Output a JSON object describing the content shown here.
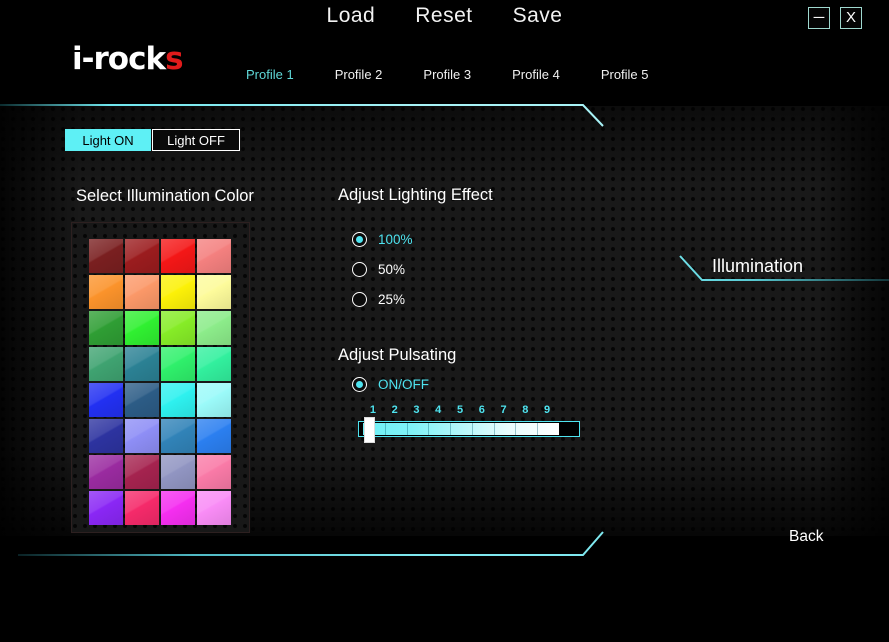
{
  "window": {
    "minimize_label": "─",
    "close_label": "X"
  },
  "topmenu": {
    "items": [
      {
        "label": "Load",
        "name": "load"
      },
      {
        "label": "Reset",
        "name": "reset"
      },
      {
        "label": "Save",
        "name": "save"
      }
    ]
  },
  "brand": {
    "text_main": "i-rock",
    "text_accent": "s",
    "accent_color": "#e01b1b"
  },
  "profiles": {
    "items": [
      {
        "label": "Profile 1",
        "selected": true
      },
      {
        "label": "Profile 2",
        "selected": false
      },
      {
        "label": "Profile 3",
        "selected": false
      },
      {
        "label": "Profile 4",
        "selected": false
      },
      {
        "label": "Profile 5",
        "selected": false
      }
    ],
    "active_color": "#5fd8d8"
  },
  "light_tabs": {
    "on_label": "Light ON",
    "off_label": "Light OFF",
    "selected": "Light ON",
    "selected_bg": "#5ef0f5"
  },
  "headings": {
    "color": "Select Illumination Color",
    "effect": "Adjust Lighting Effect",
    "pulsating": "Adjust Pulsating"
  },
  "palette": {
    "columns": 4,
    "rows": 8,
    "swatches": [
      "#7a1f20",
      "#9b1c1e",
      "#f41717",
      "#f4807f",
      "#fb932b",
      "#fb9868",
      "#fcf108",
      "#fdfb9b",
      "#2f9e34",
      "#30f031",
      "#86ec27",
      "#8cec8a",
      "#3fa371",
      "#2b8194",
      "#2ff06b",
      "#32f09e",
      "#2230f2",
      "#2c5c86",
      "#2ef1ef",
      "#9bfaf9",
      "#2d33a0",
      "#8e8ef6",
      "#3183b8",
      "#2b7ff0",
      "#9a2ba0",
      "#a5234f",
      "#9195c2",
      "#f97aa7",
      "#8a27f5",
      "#f52a6a",
      "#f52ef0",
      "#f98cf6"
    ]
  },
  "lighting_effect": {
    "options": [
      {
        "label": "100%",
        "selected": true
      },
      {
        "label": "50%",
        "selected": false
      },
      {
        "label": "25%",
        "selected": false
      }
    ],
    "selected_color": "#4ee3ef"
  },
  "pulsating": {
    "toggle_label": "ON/OFF",
    "toggle_selected": true,
    "slider": {
      "ticks": [
        "1",
        "2",
        "3",
        "4",
        "5",
        "6",
        "7",
        "8",
        "9"
      ],
      "min": 1,
      "max": 9,
      "value": 1,
      "accent_color": "#4ee3ef"
    }
  },
  "right_panel": {
    "title": "Illumination"
  },
  "footer": {
    "back_label": "Back"
  }
}
